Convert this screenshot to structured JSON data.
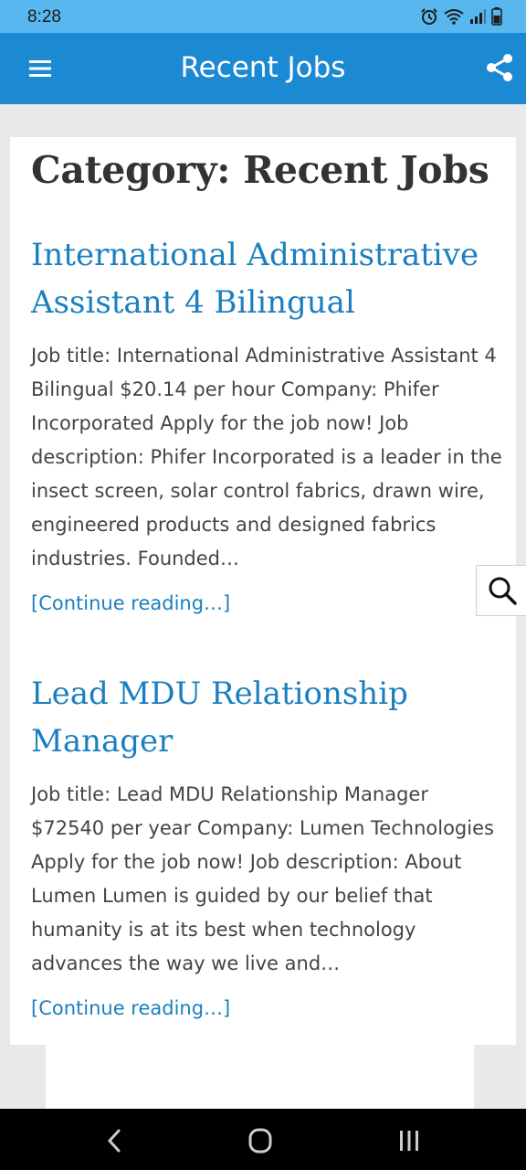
{
  "status_bar": {
    "time": "8:28",
    "icons": [
      "alarm-icon",
      "wifi-icon",
      "signal-icon",
      "battery-icon"
    ]
  },
  "app_bar": {
    "title": "Recent Jobs",
    "menu_icon": "hamburger-menu-icon",
    "share_icon": "share-icon",
    "color": "#1c8ad3"
  },
  "page": {
    "category_heading": "Category: Recent Jobs",
    "link_color": "#1b7fbf",
    "posts": [
      {
        "title": "International Administrative Assistant 4 Bilingual",
        "excerpt": "Job title: International Administrative Assistant 4 Bilingual $20.14 per hour Company: Phifer Incorporated Apply for the job now! Job description: Phifer Incorporated is a leader in the insect screen, solar control fabrics, drawn wire, engineered products and designed fabrics industries. Founded…",
        "continue_label": "[Continue reading…]"
      },
      {
        "title": "Lead MDU Relationship Manager",
        "excerpt": "Job title: Lead MDU Relationship Manager $72540 per year Company: Lumen Technologies Apply for the job now! Job description: About Lumen Lumen is guided by our belief that humanity is at its best when technology advances the way we live and…",
        "continue_label": "[Continue reading…]"
      }
    ]
  },
  "search_button": {
    "icon": "search-icon"
  },
  "nav_bar": {
    "buttons": [
      "back-icon",
      "home-icon",
      "recent-apps-icon"
    ]
  }
}
